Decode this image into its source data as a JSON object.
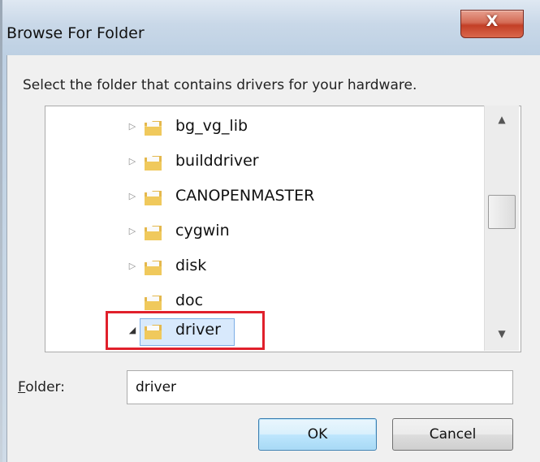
{
  "window": {
    "title": "Browse For Folder",
    "close_label": "X"
  },
  "instruction": "Select the folder that contains drivers for your hardware.",
  "tree": {
    "items": [
      {
        "name": "bg_vg_lib",
        "expander": "collapsed"
      },
      {
        "name": "builddriver",
        "expander": "collapsed"
      },
      {
        "name": "CANOPENMASTER",
        "expander": "collapsed"
      },
      {
        "name": "cygwin",
        "expander": "collapsed"
      },
      {
        "name": "disk",
        "expander": "collapsed"
      },
      {
        "name": "doc",
        "expander": "none"
      },
      {
        "name": "driver",
        "expander": "expanded",
        "selected": true
      }
    ]
  },
  "folder_field": {
    "label_accel": "F",
    "label_rest": "older:",
    "value": "driver"
  },
  "buttons": {
    "ok": "OK",
    "cancel": "Cancel"
  },
  "colors": {
    "highlight": "#e0202b",
    "selection": "#d8e9fc",
    "close": "#c33f26"
  }
}
